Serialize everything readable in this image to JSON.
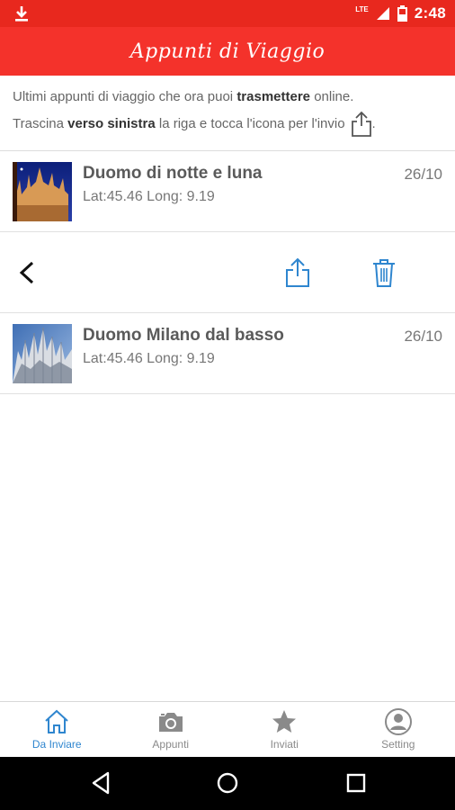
{
  "status_bar": {
    "time": "2:48",
    "network": "LTE",
    "icons": [
      "download-icon",
      "signal-icon",
      "battery-icon"
    ]
  },
  "app_bar": {
    "title": "Appunti di Viaggio"
  },
  "intro": {
    "line1_before": "Ultimi appunti di viaggio che ora puoi ",
    "line1_bold": "trasmettere",
    "line1_after": " online.",
    "line2_before": "Trascina ",
    "line2_bold": "verso sinistra",
    "line2_after": " la riga e tocca l'icona per l'invio",
    "line2_end": "."
  },
  "notes": [
    {
      "title": "Duomo di notte e luna",
      "coords": "Lat:45.46 Long: 9.19",
      "date": "26/10"
    },
    {
      "title": "Duomo Milano dal basso",
      "coords": "Lat:45.46 Long: 9.19",
      "date": "26/10"
    }
  ],
  "swipe_actions": {
    "icons": [
      "back-chevron-icon",
      "share-icon",
      "trash-icon"
    ]
  },
  "bottom_nav": {
    "tabs": [
      {
        "label": "Da Inviare",
        "icon": "home-icon",
        "active": true
      },
      {
        "label": "Appunti",
        "icon": "camera-icon",
        "active": false
      },
      {
        "label": "Inviati",
        "icon": "star-icon",
        "active": false
      },
      {
        "label": "Setting",
        "icon": "user-icon",
        "active": false
      }
    ]
  },
  "colors": {
    "status_bar": "#e8281e",
    "app_bar": "#f4322b",
    "accent_blue": "#2f86cf",
    "inactive": "#8a8a8a"
  }
}
